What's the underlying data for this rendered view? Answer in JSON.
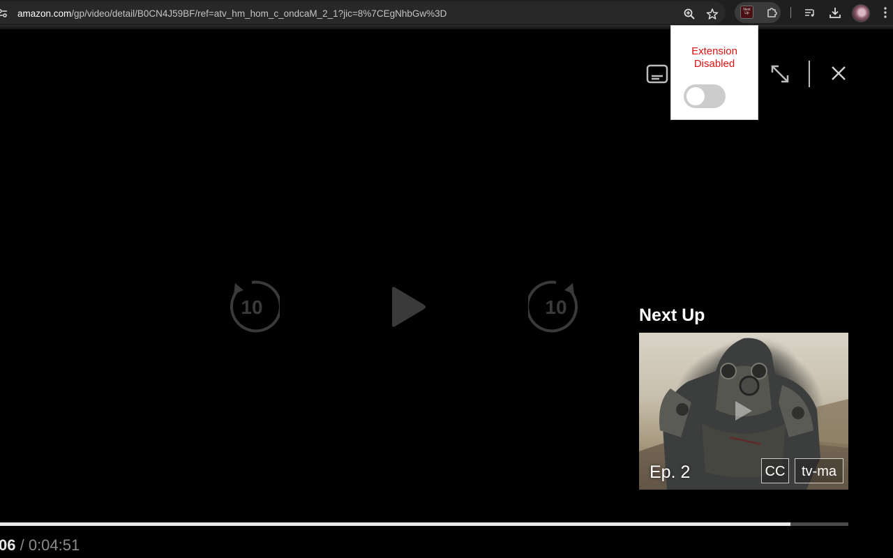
{
  "browser": {
    "url_domain": "amazon.com",
    "url_path": "/gp/video/detail/B0CN4J59BF/ref=atv_hm_hom_c_ondcaM_2_1?jic=8%7CEgNhbGw%3D",
    "extension_badge": "Next Up",
    "icons": [
      "site-info-icon",
      "zoom-icon",
      "bookmark-star-icon",
      "next-up-extension-icon",
      "extensions-puzzle-icon",
      "media-queue-icon",
      "download-icon",
      "profile-avatar",
      "more-menu-icon"
    ]
  },
  "extension_popup": {
    "status": "Extension Disabled",
    "toggle_on": false
  },
  "player": {
    "top_controls": [
      "subtitles-icon",
      "fullscreen-icon",
      "close-icon"
    ],
    "center_controls": {
      "rewind_label": "10",
      "forward_label": "10"
    },
    "next_up": {
      "title": "Next Up",
      "episode": "Ep. 2",
      "badges": [
        "CC",
        "tv-ma"
      ]
    },
    "progress_fraction": 0.932,
    "time_current": "06",
    "time_separator": " / ",
    "time_total": "0:04:51"
  },
  "colors": {
    "background": "#000000",
    "popup_status": "#e01010",
    "toggle_off": "#cccccc",
    "progress_fill": "#e8e8e8",
    "progress_track": "#4a4a4a"
  }
}
